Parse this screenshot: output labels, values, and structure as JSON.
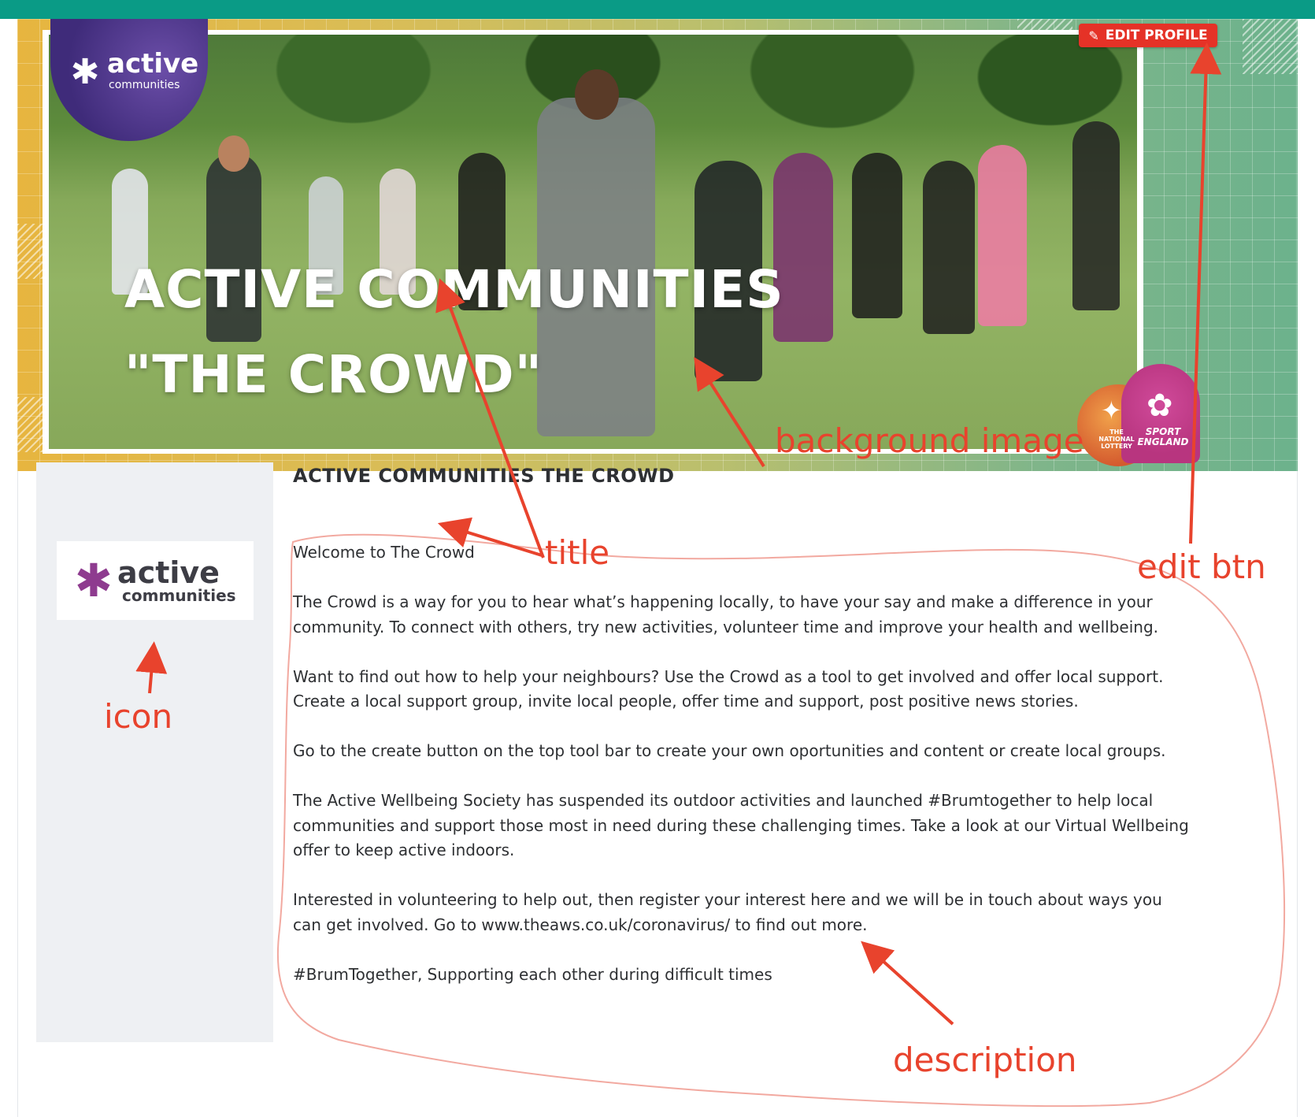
{
  "banner": {
    "title_line1": "ACTIVE COMMUNITIES",
    "title_line2": "\"THE CROWD\"",
    "logo_word": "active",
    "logo_sub": "communities",
    "partner1_text": "THE NATIONAL LOTTERY",
    "partner2_text": "SPORT ENGLAND"
  },
  "edit_button": {
    "label": "EDIT PROFILE",
    "icon": "pencil-icon"
  },
  "group": {
    "title": "ACTIVE COMMUNITIES THE CROWD",
    "icon_word": "active",
    "icon_sub": "communities"
  },
  "description": {
    "p1": "Welcome to The Crowd",
    "p2": "The Crowd is a way for you to hear what’s happening locally, to have your say and make a difference in your community. To connect with others, try new activities, volunteer time and improve your health and wellbeing.",
    "p3": "Want to find out how to help your neighbours? Use the Crowd as a tool to get involved and offer local support. Create a local support group, invite local people, offer time and support, post positive news stories.",
    "p4": "Go to the create button on the top tool bar to create your own oportunities and content or create local groups.",
    "p5": "The Active Wellbeing Society has suspended its outdoor activities and launched #Brumtogether to help local communities and support those most in need during these challenging times. Take a look at our Virtual Wellbeing offer to keep active indoors.",
    "p6": "Interested in volunteering to help out, then register your interest here and we will be in touch about ways you can get involved. Go to www.theaws.co.uk/coronavirus/ to find out more.",
    "p7": "#BrumTogether, Supporting each other during difficult times"
  },
  "annotations": {
    "background_image": "background image",
    "title": "title",
    "edit_btn": "edit btn",
    "icon": "icon",
    "description": "description"
  },
  "colors": {
    "topbar": "#0a9b86",
    "edit_button": "#e53227",
    "annotation": "#e8432d",
    "sidebar": "#eef0f3"
  }
}
